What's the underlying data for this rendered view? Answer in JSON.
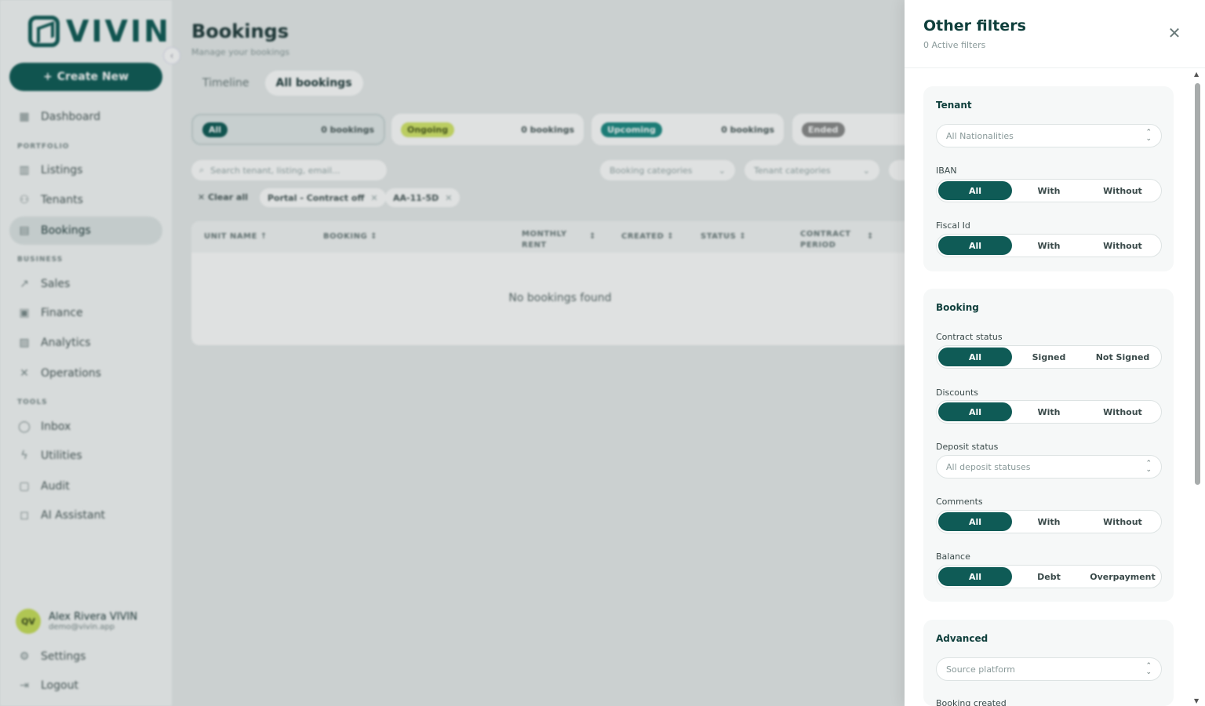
{
  "sidebar": {
    "logo_text": "VIVIN",
    "create_label": "Create New",
    "sections": {
      "portfolio": "PORTFOLIO",
      "business": "BUSINESS",
      "tools": "TOOLS"
    },
    "items": {
      "dashboard": "Dashboard",
      "listings": "Listings",
      "tenants": "Tenants",
      "bookings": "Bookings",
      "sales": "Sales",
      "finance": "Finance",
      "analytics": "Analytics",
      "operations": "Operations",
      "inbox": "Inbox",
      "utilities": "Utilities",
      "audit": "Audit",
      "ai_assistant": "AI Assistant"
    },
    "user": {
      "initials": "QV",
      "name": "Alex Rivera VIVIN",
      "email": "demo@vivin.app"
    },
    "settings": "Settings",
    "logout": "Logout"
  },
  "main": {
    "title": "Bookings",
    "subtitle": "Manage your bookings",
    "tabs": {
      "timeline": "Timeline",
      "all": "All bookings"
    },
    "status_cards": {
      "all": {
        "label": "All",
        "count": "0 bookings"
      },
      "ongoing": {
        "label": "Ongoing",
        "count": "0 bookings"
      },
      "upcoming": {
        "label": "Upcoming",
        "count": "0 bookings"
      },
      "ended": {
        "label": "Ended"
      }
    },
    "search_placeholder": "Search tenant, listing, email...",
    "booking_categories": "Booking categories",
    "tenant_categories": "Tenant categories",
    "clear_all": "Clear all",
    "chips": {
      "portal": "Portal - Contract off",
      "unit": "AA-11-5D"
    },
    "columns": {
      "unit": "UNIT NAME",
      "booking": "BOOKING",
      "rent_1": "MONTHLY",
      "rent_2": "RENT",
      "created": "CREATED",
      "status": "STATUS",
      "contract_1": "CONTRACT",
      "contract_2": "PERIOD"
    },
    "empty": "No bookings found"
  },
  "panel": {
    "title": "Other filters",
    "subtitle": "0 Active filters",
    "tenant": {
      "title": "Tenant",
      "nationality_placeholder": "All Nationalities",
      "iban_label": "IBAN",
      "iban_options": [
        "All",
        "With",
        "Without"
      ],
      "fiscal_label": "Fiscal Id",
      "fiscal_options": [
        "All",
        "With",
        "Without"
      ]
    },
    "booking": {
      "title": "Booking",
      "contract_label": "Contract status",
      "contract_options": [
        "All",
        "Signed",
        "Not Signed"
      ],
      "discounts_label": "Discounts",
      "discounts_options": [
        "All",
        "With",
        "Without"
      ],
      "deposit_label": "Deposit status",
      "deposit_placeholder": "All deposit statuses",
      "comments_label": "Comments",
      "comments_options": [
        "All",
        "With",
        "Without"
      ],
      "balance_label": "Balance",
      "balance_options": [
        "All",
        "Debt",
        "Overpayment"
      ]
    },
    "advanced": {
      "title": "Advanced",
      "source_placeholder": "Source platform",
      "booking_created_label": "Booking created"
    }
  },
  "colors": {
    "brand": "#0f5b56",
    "ongoing": "#d5e86a",
    "upcoming": "#1c8a83",
    "ended": "#8a8a8a"
  }
}
